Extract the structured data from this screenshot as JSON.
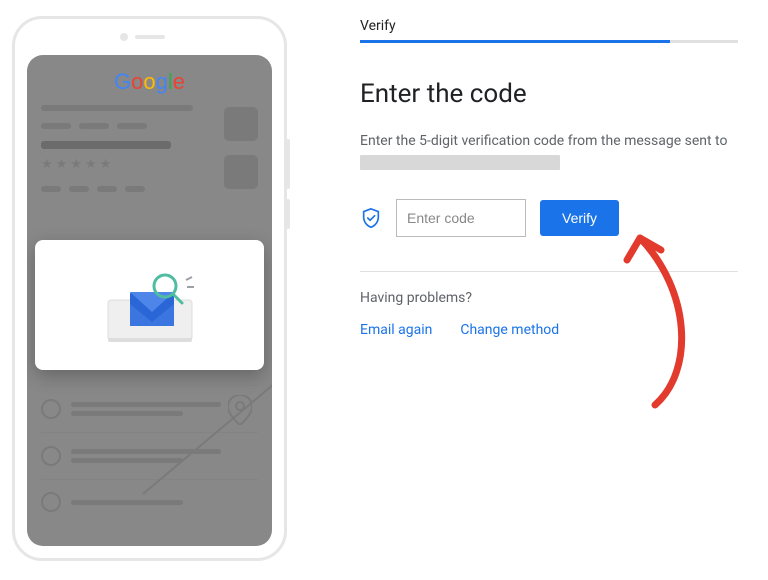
{
  "phone": {
    "logo": "Google"
  },
  "panel": {
    "step_label": "Verify",
    "heading": "Enter the code",
    "instruction_prefix": "Enter the 5-digit verification code from the message sent to",
    "code_placeholder": "Enter code",
    "verify_button": "Verify",
    "problems_label": "Having problems?",
    "link_email": "Email again",
    "link_change": "Change method"
  }
}
